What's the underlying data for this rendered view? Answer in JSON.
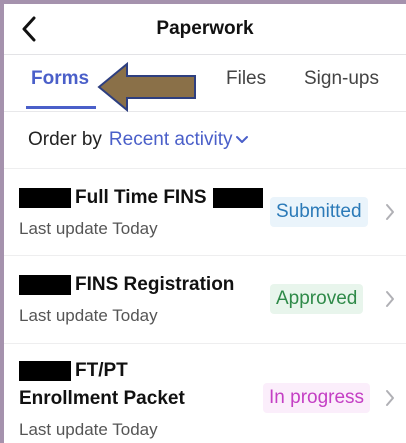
{
  "header": {
    "title": "Paperwork"
  },
  "tabs": [
    {
      "label": "Forms",
      "active": true
    },
    {
      "label": "Files",
      "active": false
    },
    {
      "label": "Sign-ups",
      "active": false
    }
  ],
  "order": {
    "label": "Order by",
    "value": "Recent activity"
  },
  "items": [
    {
      "title": "Full Time FINS",
      "subtitle": "Last update Today",
      "status": "Submitted",
      "status_color": "#2b7ab8"
    },
    {
      "title": "FINS Registration",
      "subtitle": "Last update Today",
      "status": "Approved",
      "status_color": "#2f8a49"
    },
    {
      "title_line1": "FT/PT",
      "title_line2": "Enrollment Packet",
      "subtitle": "Last update Today",
      "status": "In progress",
      "status_color": "#c43fc4"
    }
  ],
  "colors": {
    "accent": "#4a5fc9",
    "annotation_arrow": "#8a7048"
  }
}
